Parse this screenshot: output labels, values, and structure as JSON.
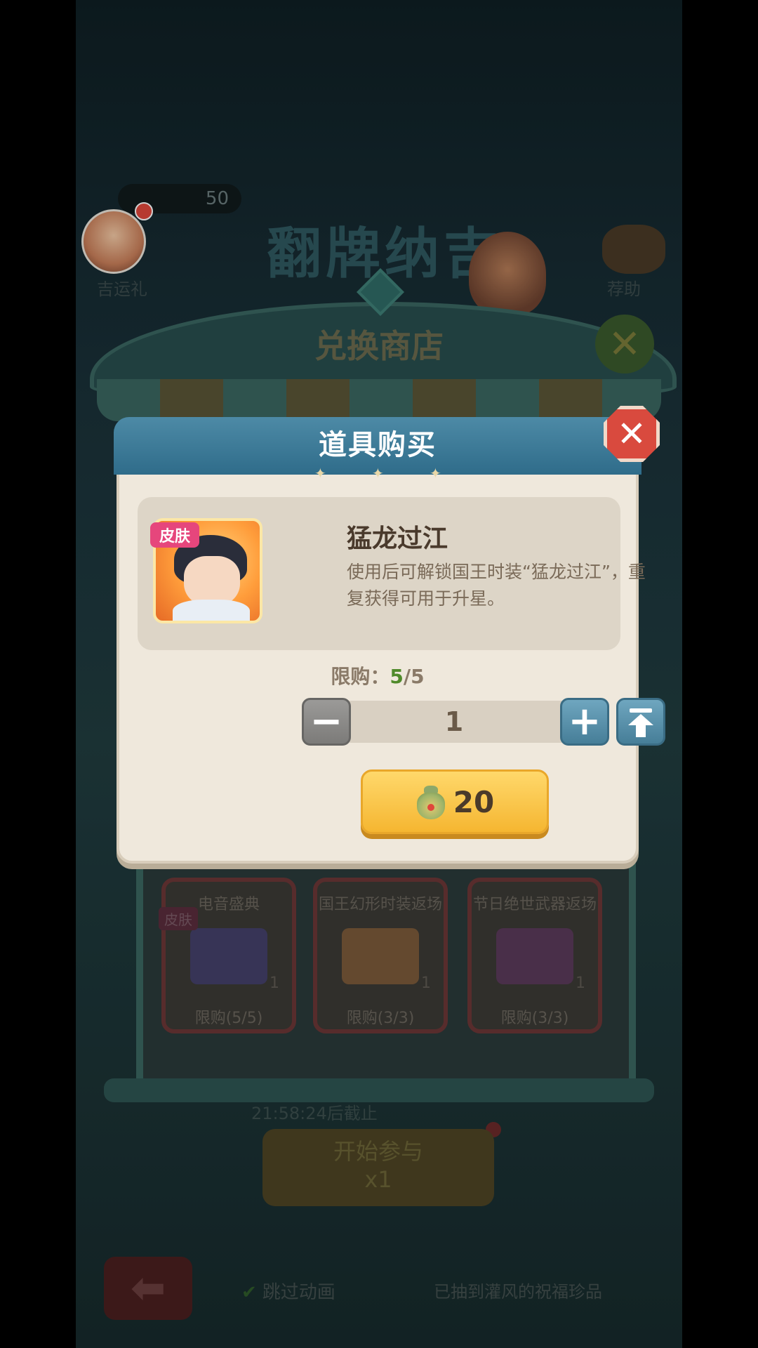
{
  "background": {
    "game_title": "翻牌纳吉",
    "counter_value": "50",
    "left_label": "吉运礼",
    "right_label": "荐助",
    "shop_title": "兑换商店",
    "shop_close_glyph": "✕",
    "cards": [
      {
        "name": "电音盛典",
        "badge": "皮肤",
        "count": "1",
        "limit": "限购(5/5)",
        "color": "#44406a"
      },
      {
        "name": "国王幻形时装返场",
        "badge": "",
        "count": "1",
        "limit": "限购(3/3)",
        "color": "#7a5a3a"
      },
      {
        "name": "节日绝世武器返场",
        "badge": "",
        "count": "1",
        "limit": "限购(3/3)",
        "color": "#5a3a5a"
      }
    ],
    "timer_text": "21:58:24后截止",
    "start_button": {
      "line1": "开始参与",
      "line2": "x1"
    },
    "back_glyph": "⬅",
    "skip_label": "跳过动画",
    "got_text": "已抽到灌风的祝福珍品"
  },
  "modal": {
    "title": "道具购买",
    "close_glyph": "✕",
    "item": {
      "badge": "皮肤",
      "name": "猛龙过江",
      "description": "使用后可解锁国王时装“猛龙过江”，重复获得可用于升星。"
    },
    "limit": {
      "label": "限购：",
      "current": "5",
      "separator": "/",
      "max": "5"
    },
    "quantity": "1",
    "minus_glyph": "−",
    "plus_glyph": "+",
    "price": "20"
  },
  "colors": {
    "header_blue": "#2f6c8a",
    "buy_button_gold": "#f5b631",
    "close_red": "#d94a3e",
    "limit_green": "#4f8a2a",
    "skin_badge_pink": "#e6467c"
  },
  "icons": {
    "currency": "lucky-bag-icon",
    "max": "max-arrow-icon",
    "close": "close-icon"
  }
}
